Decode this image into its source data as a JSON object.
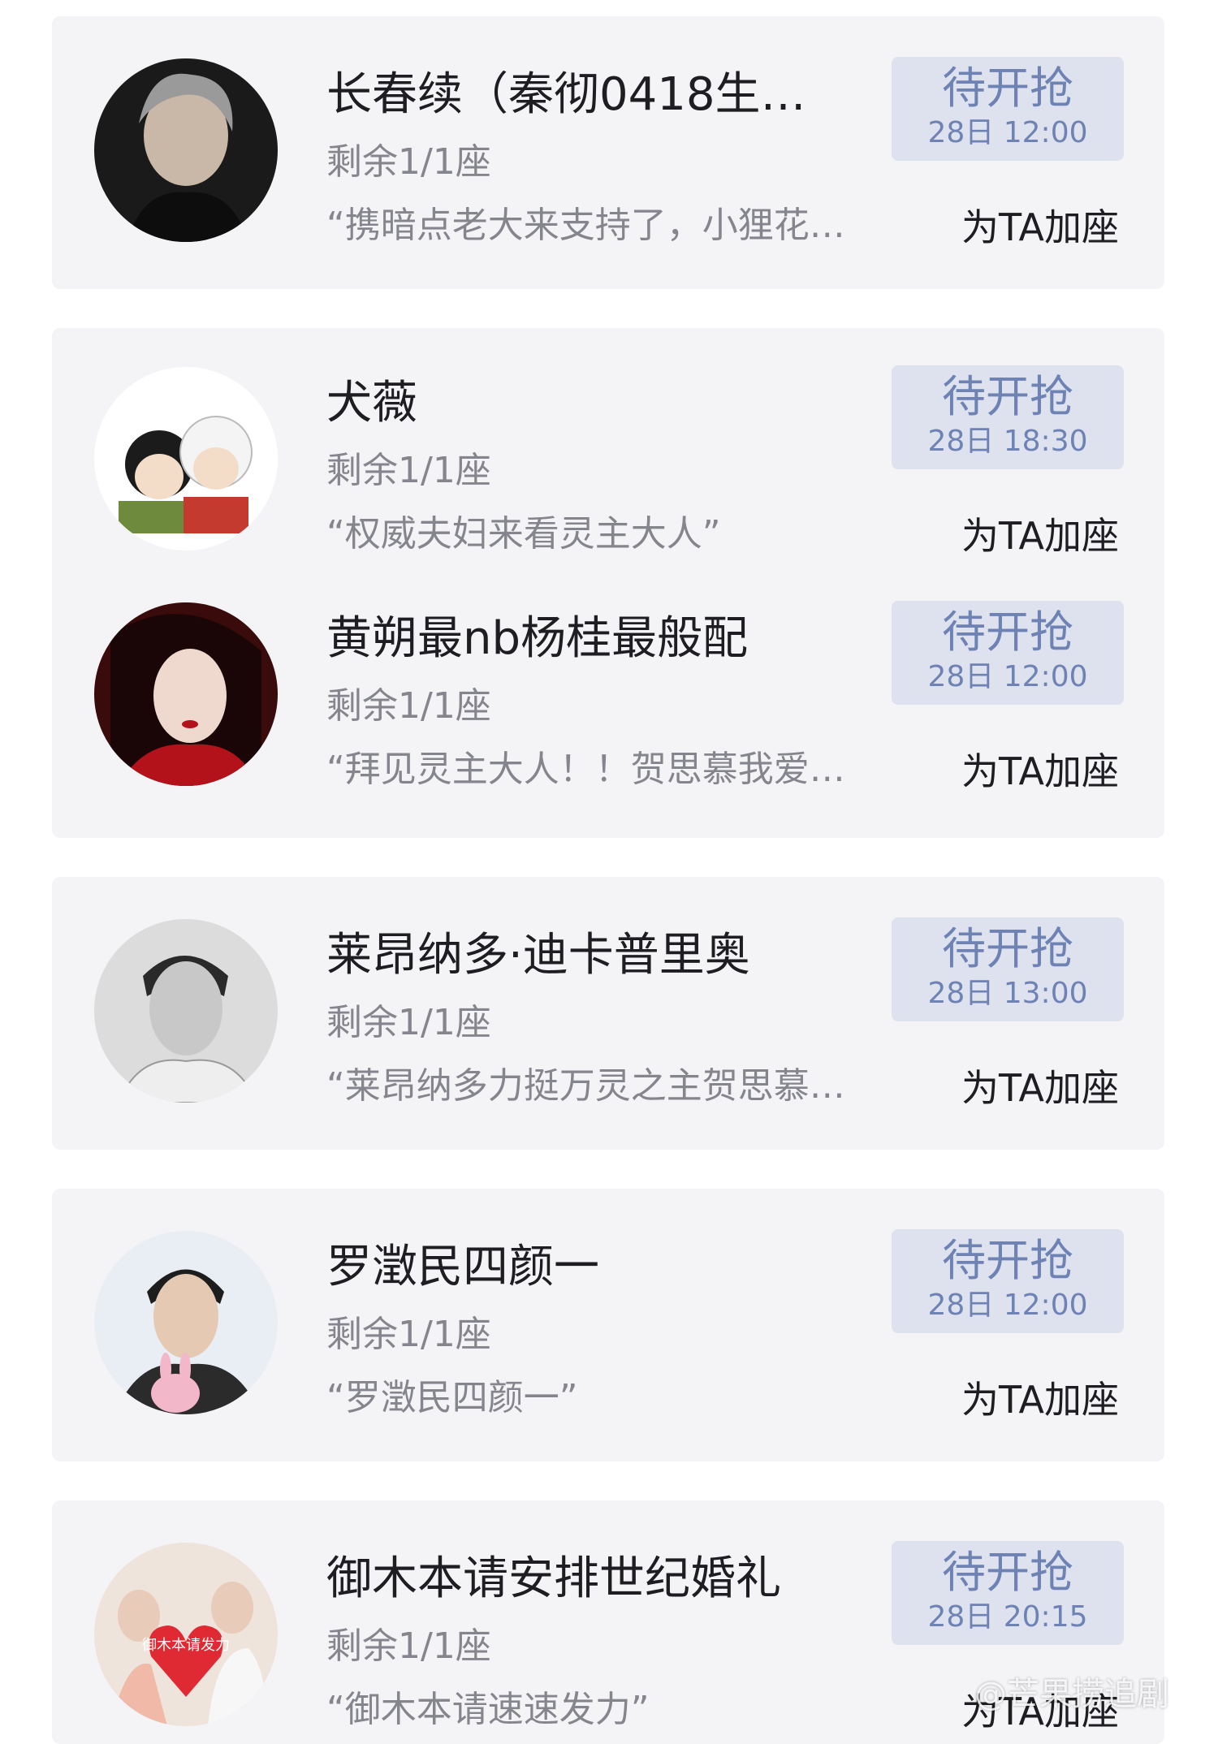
{
  "entries": [
    {
      "name": "长春续（秦彻0418生…",
      "remaining": "剩余1/1座",
      "quote": "“携暗点老大来支持了，小狸花…",
      "status": "待开抢",
      "time": "28日 12:00",
      "action": "为TA加座"
    },
    {
      "name": "犬薇",
      "remaining": "剩余1/1座",
      "quote": "“权威夫妇来看灵主大人”",
      "status": "待开抢",
      "time": "28日 18:30",
      "action": "为TA加座"
    },
    {
      "name": "黄朔最nb杨桂最般配",
      "remaining": "剩余1/1座",
      "quote": "“拜见灵主大人！！贺思慕我爱…",
      "status": "待开抢",
      "time": "28日 12:00",
      "action": "为TA加座"
    },
    {
      "name": "莱昂纳多·迪卡普里奥",
      "remaining": "剩余1/1座",
      "quote": "“莱昂纳多力挺万灵之主贺思慕…",
      "status": "待开抢",
      "time": "28日 13:00",
      "action": "为TA加座"
    },
    {
      "name": "罗澂民四颜一",
      "remaining": "剩余1/1座",
      "quote": "“罗澂民四颜一”",
      "status": "待开抢",
      "time": "28日 12:00",
      "action": "为TA加座"
    },
    {
      "name": "御木本请安排世纪婚礼",
      "remaining": "剩余1/1座",
      "quote": "“御木本请速速发力”",
      "status": "待开抢",
      "time": "28日 20:15",
      "action": "为TA加座",
      "avatar_text": "御木本请发力"
    }
  ],
  "watermark": "@芒果捞追剧",
  "colors": {
    "card_bg": "#f4f4f7",
    "badge_bg": "#dde2ee",
    "badge_text": "#6e82b4",
    "primary_text": "#1e1e22",
    "secondary_text": "#85858d"
  }
}
